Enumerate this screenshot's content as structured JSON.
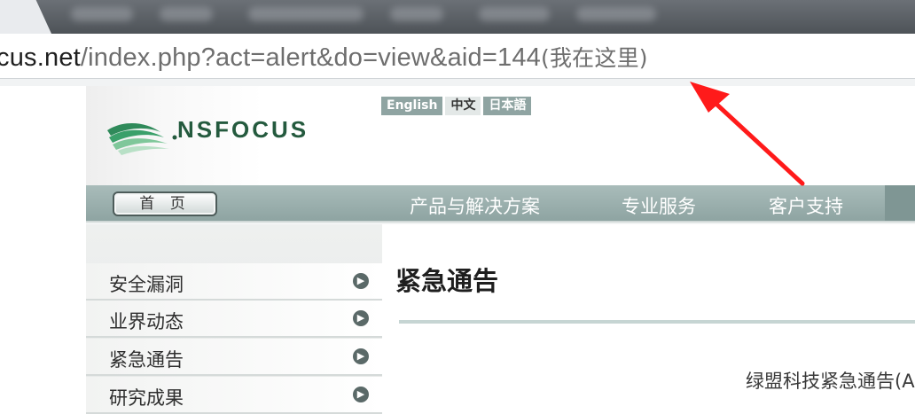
{
  "browser": {
    "url_host_part": "cus.net",
    "url_path_part": "/index.php?act=alert&do=view&aid=144",
    "url_note": "(我在这里)"
  },
  "site": {
    "logo_text": "NSFOCUS",
    "languages": [
      {
        "label": "English",
        "active": false
      },
      {
        "label": "中文",
        "active": true
      },
      {
        "label": "日本語",
        "active": false
      }
    ],
    "nav": {
      "home": "首 页",
      "items": [
        "产品与解决方案",
        "专业服务",
        "客户支持"
      ]
    },
    "sidebar": {
      "items": [
        "安全漏洞",
        "业界动态",
        "紧急通告",
        "研究成果"
      ]
    },
    "main": {
      "title": "紧急通告",
      "subtitle": "绿盟科技紧急通告(A"
    }
  },
  "colors": {
    "nav_bg": "#9fb3b1",
    "logo_green": "#245a3e",
    "annotation_red": "#ff1a1a"
  },
  "icons": {
    "sidebar_arrow": "circle-arrow-right-icon",
    "annotation": "red-arrow-icon"
  }
}
